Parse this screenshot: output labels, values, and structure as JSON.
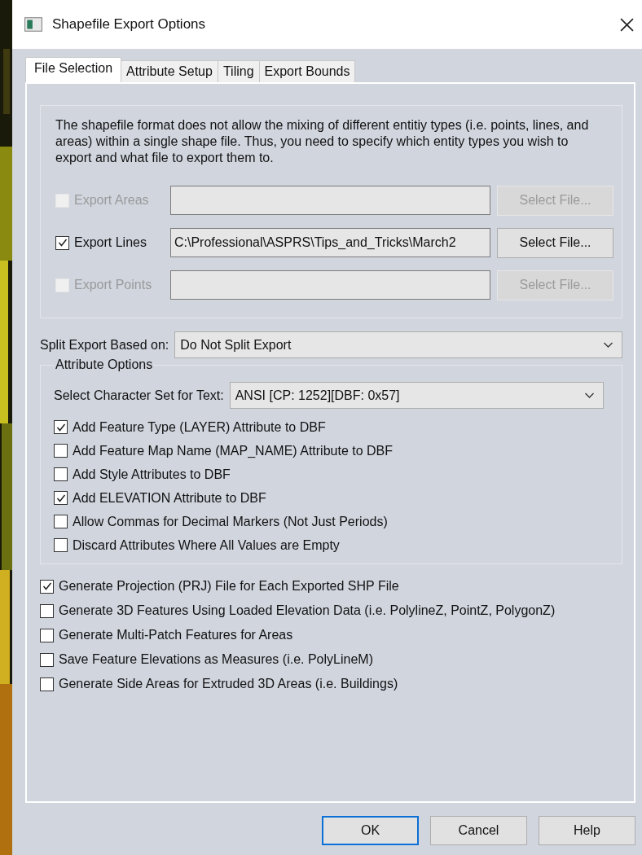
{
  "window": {
    "title": "Shapefile Export Options"
  },
  "tabs": [
    {
      "label": "File Selection",
      "selected": true
    },
    {
      "label": "Attribute Setup",
      "selected": false
    },
    {
      "label": "Tiling",
      "selected": false
    },
    {
      "label": "Export Bounds",
      "selected": false
    }
  ],
  "description": "The shapefile format does not allow the mixing of different entitiy types (i.e. points, lines, and areas) within a single shape file. Thus, you need to specify which entity types you wish to export and what file to export them to.",
  "exports": [
    {
      "label": "Export Areas",
      "checked": false,
      "disabled": true,
      "button": "Select File..."
    },
    {
      "label": "Export Lines",
      "checked": true,
      "disabled": false,
      "path": "C:\\Professional\\ASPRS\\Tips_and_Tricks\\March2",
      "button": "Select File..."
    },
    {
      "label": "Export Points",
      "checked": false,
      "disabled": true,
      "button": "Select File..."
    }
  ],
  "split": {
    "label": "Split Export Based on:",
    "value": "Do Not Split Export"
  },
  "attribute_options": {
    "title": "Attribute Options",
    "charset_label": "Select Character Set for Text:",
    "charset_value": "ANSI [CP: 1252][DBF: 0x57]",
    "options": [
      {
        "label": "Add Feature Type (LAYER) Attribute to DBF",
        "checked": true
      },
      {
        "label": "Add Feature Map Name (MAP_NAME) Attribute to DBF",
        "checked": false
      },
      {
        "label": "Add Style Attributes to DBF",
        "checked": false
      },
      {
        "label": "Add ELEVATION Attribute to DBF",
        "checked": true
      },
      {
        "label": "Allow Commas for Decimal Markers (Not Just Periods)",
        "checked": false
      },
      {
        "label": "Discard Attributes Where All Values are Empty",
        "checked": false
      }
    ]
  },
  "options": [
    {
      "label": "Generate Projection (PRJ) File for Each Exported SHP File",
      "checked": true
    },
    {
      "label": "Generate 3D Features Using Loaded Elevation Data (i.e. PolylineZ, PointZ, PolygonZ)",
      "checked": false
    },
    {
      "label": "Generate Multi-Patch Features for Areas",
      "checked": false
    },
    {
      "label": "Save Feature Elevations as Measures (i.e. PolyLineM)",
      "checked": false
    },
    {
      "label": "Generate Side Areas for Extruded 3D Areas (i.e. Buildings)",
      "checked": false
    }
  ],
  "buttons": [
    {
      "label": "OK",
      "default": true
    },
    {
      "label": "Cancel",
      "default": false
    },
    {
      "label": "Help",
      "default": false
    }
  ]
}
